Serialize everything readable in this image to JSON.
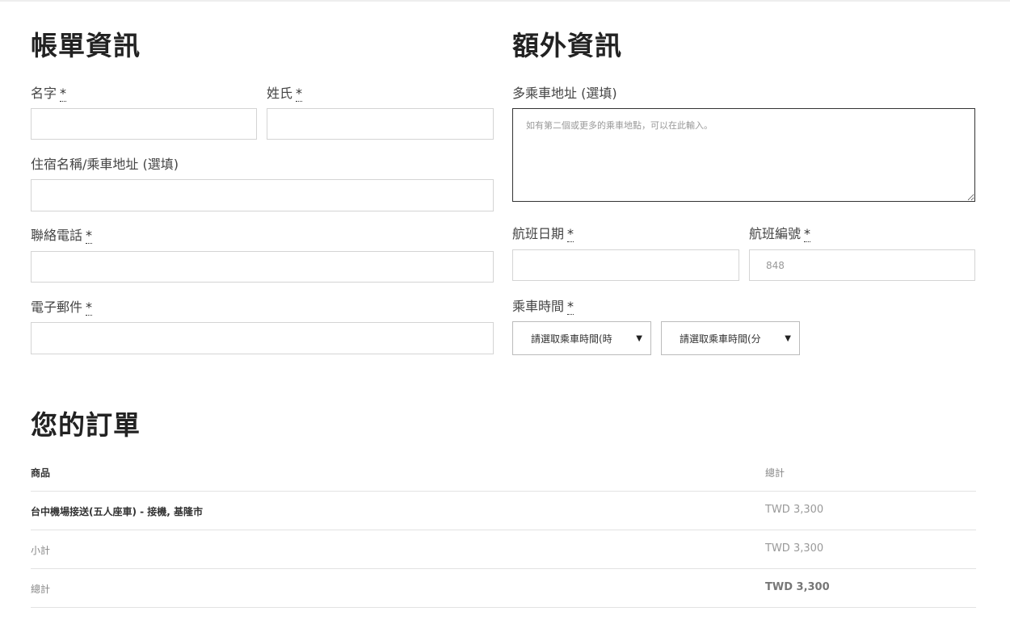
{
  "billing": {
    "title": "帳單資訊",
    "first_name_label": "名字",
    "last_name_label": "姓氏",
    "address_label": "住宿名稱/乘車地址 (選填)",
    "phone_label": "聯絡電話",
    "email_label": "電子郵件",
    "required_mark": "*"
  },
  "additional": {
    "title": "額外資訊",
    "multi_address_label": "多乘車地址 (選填)",
    "multi_address_placeholder": "如有第二個或更多的乘車地點，可以在此輸入。",
    "flight_date_label": "航班日期",
    "flight_number_label": "航班編號",
    "flight_number_placeholder": "848",
    "pickup_time_label": "乘車時間",
    "hour_select": "請選取乘車時間(時",
    "minute_select": "請選取乘車時間(分"
  },
  "order": {
    "title": "您的訂單",
    "col_product": "商品",
    "col_total": "總計",
    "rows": [
      {
        "label": "台中機場接送(五人座車) - 接機, 基隆市",
        "value": "TWD 3,300"
      },
      {
        "label": "小計",
        "value": "TWD 3,300"
      },
      {
        "label": "總計",
        "value": "TWD 3,300"
      }
    ]
  }
}
